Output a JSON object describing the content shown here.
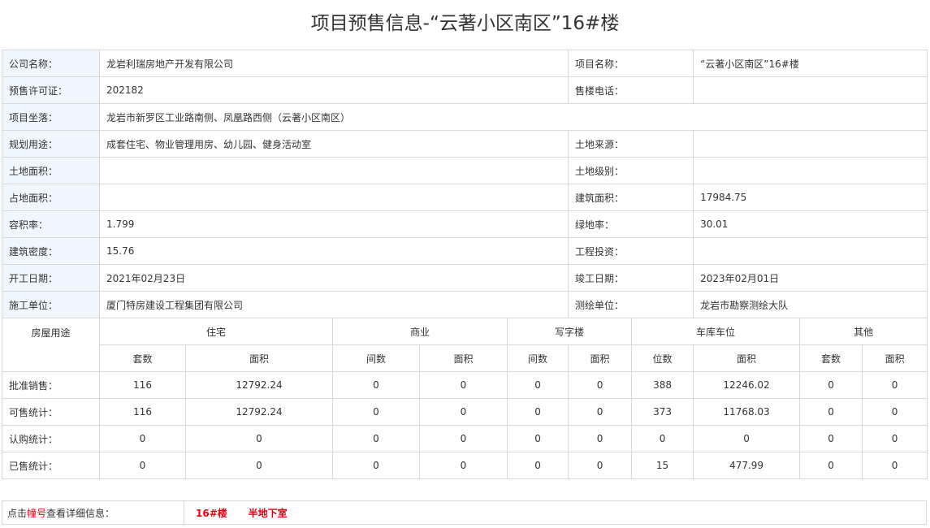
{
  "page": {
    "title": "项目预售信息-“云著小区南区”16#楼"
  },
  "info": {
    "company_label": "公司名称：",
    "company": "龙岩利瑞房地产开发有限公司",
    "project_name_label": "项目名称：",
    "project_name": "“云著小区南区”16#楼",
    "permit_label": "预售许可证：",
    "permit": "202182",
    "phone_label": "售楼电话：",
    "phone": "",
    "location_label": "项目坐落：",
    "location": "龙岩市新罗区工业路南侧、凤凰路西侧（云著小区南区）",
    "usage_label": "规划用途：",
    "usage": "成套住宅、物业管理用房、幼儿园、健身活动室",
    "land_source_label": "土地来源：",
    "land_source": "",
    "land_area_label": "土地面积：",
    "land_area": "",
    "land_level_label": "土地级别：",
    "land_level": "",
    "footprint_label": "占地面积：",
    "footprint": "",
    "build_area_label": "建筑面积：",
    "build_area": "17984.75",
    "plot_ratio_label": "容积率：",
    "plot_ratio": "1.799",
    "green_ratio_label": "绿地率：",
    "green_ratio": "30.01",
    "density_label": "建筑密度：",
    "density": "15.76",
    "investment_label": "工程投资：",
    "investment": "",
    "start_label": "开工日期：",
    "start": "2021年02月23日",
    "finish_label": "竣工日期：",
    "finish": "2023年02月01日",
    "builder_label": "施工单位：",
    "builder": "厦门特房建设工程集团有限公司",
    "surveyor_label": "测绘单位：",
    "surveyor": "龙岩市勘察测绘大队"
  },
  "stats": {
    "usage_header": "房屋用途",
    "groups": [
      "住宅",
      "商业",
      "写字楼",
      "车库车位",
      "其他"
    ],
    "subheaders": [
      "套数",
      "面积",
      "间数",
      "面积",
      "间数",
      "面积",
      "位数",
      "面积",
      "套数",
      "面积"
    ],
    "rows": [
      {
        "label": "批准销售：",
        "values": [
          "116",
          "12792.24",
          "0",
          "0",
          "0",
          "0",
          "388",
          "12246.02",
          "0",
          "0"
        ]
      },
      {
        "label": "可售统计：",
        "values": [
          "116",
          "12792.24",
          "0",
          "0",
          "0",
          "0",
          "373",
          "11768.03",
          "0",
          "0"
        ]
      },
      {
        "label": "认购统计：",
        "values": [
          "0",
          "0",
          "0",
          "0",
          "0",
          "0",
          "0",
          "0",
          "0",
          "0"
        ]
      },
      {
        "label": "已售统计：",
        "values": [
          "0",
          "0",
          "0",
          "0",
          "0",
          "0",
          "15",
          "477.99",
          "0",
          "0"
        ]
      }
    ]
  },
  "footer": {
    "prefix": "点击",
    "highlight": "幢号",
    "suffix": "查看详细信息：",
    "links": [
      "16#楼",
      "半地下室"
    ]
  },
  "colors": {
    "label_bg": "#f0f6fd",
    "border": "#d9d9d9",
    "link": "#e60012"
  }
}
